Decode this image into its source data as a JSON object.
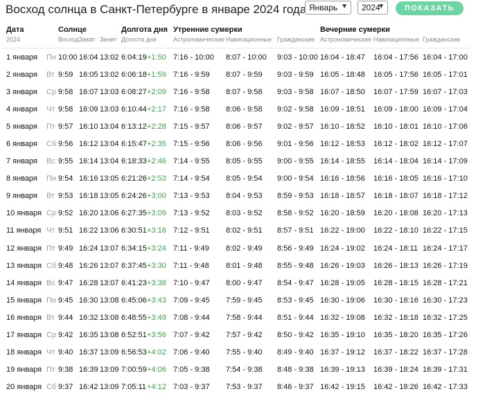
{
  "title": "Восход солнца в Санкт-Петербурге в январе 2024 года",
  "controls": {
    "month": "Январь",
    "year": "2024",
    "button": "ПОКАЗАТЬ"
  },
  "headers": {
    "date": "Дата",
    "year": "2024",
    "sun": "Солнце",
    "daylen": "Долгота дня",
    "morning": "Утренние сумерки",
    "evening": "Вечерние сумерки",
    "sub": [
      "Восход",
      "Закат",
      "Зенит",
      "Долгота дня",
      "Астрономические",
      "Навигационные",
      "Гражданские",
      "Астрономические",
      "Навигационные",
      "Гражданские"
    ]
  },
  "rows": [
    {
      "d": "1 января",
      "w": "Пн",
      "rise": "10:00",
      "set": "16:04",
      "zen": "13:02",
      "len": "6:04:19",
      "dl": "+1:50",
      "ma": "7:16 - 10:00",
      "mn": "8:07 - 10:00",
      "mc": "9:03 - 10:00",
      "ea": "16:04 - 18:47",
      "en": "16:04 - 17:56",
      "ec": "16:04 - 17:00"
    },
    {
      "d": "2 января",
      "w": "Вт",
      "rise": "9:59",
      "set": "16:05",
      "zen": "13:02",
      "len": "6:06:18",
      "dl": "+1:59",
      "ma": "7:16 - 9:59",
      "mn": "8:07 - 9:59",
      "mc": "9:03 - 9:59",
      "ea": "16:05 - 18:48",
      "en": "16:05 - 17:56",
      "ec": "16:05 - 17:01"
    },
    {
      "d": "3 января",
      "w": "Ср",
      "rise": "9:58",
      "set": "16:07",
      "zen": "13:03",
      "len": "6:08:27",
      "dl": "+2:09",
      "ma": "7:16 - 9:58",
      "mn": "8:07 - 9:58",
      "mc": "9:03 - 9:58",
      "ea": "16:07 - 18:50",
      "en": "16:07 - 17:59",
      "ec": "16:07 - 17:03"
    },
    {
      "d": "4 января",
      "w": "Чт",
      "rise": "9:58",
      "set": "16:09",
      "zen": "13:03",
      "len": "6:10:44",
      "dl": "+2:17",
      "ma": "7:16 - 9:58",
      "mn": "8:06 - 9:58",
      "mc": "9:02 - 9:58",
      "ea": "16:09 - 18:51",
      "en": "16:09 - 18:00",
      "ec": "16:09 - 17:04"
    },
    {
      "d": "5 января",
      "w": "Пт",
      "rise": "9:57",
      "set": "16:10",
      "zen": "13:04",
      "len": "6:13:12",
      "dl": "+2:28",
      "ma": "7:15 - 9:57",
      "mn": "8:06 - 9:57",
      "mc": "9:02 - 9:57",
      "ea": "16:10 - 18:52",
      "en": "16:10 - 18:01",
      "ec": "16:10 - 17:06"
    },
    {
      "d": "6 января",
      "w": "Сб",
      "rise": "9:56",
      "set": "16:12",
      "zen": "13:04",
      "len": "6:15:47",
      "dl": "+2:35",
      "ma": "7:15 - 9:56",
      "mn": "8:06 - 9:56",
      "mc": "9:01 - 9:56",
      "ea": "16:12 - 18:53",
      "en": "16:12 - 18:02",
      "ec": "16:12 - 17:07"
    },
    {
      "d": "7 января",
      "w": "Вс",
      "rise": "9:55",
      "set": "16:14",
      "zen": "13:04",
      "len": "6:18:33",
      "dl": "+2:46",
      "ma": "7:14 - 9:55",
      "mn": "8:05 - 9:55",
      "mc": "9:00 - 9:55",
      "ea": "16:14 - 18:55",
      "en": "16:14 - 18:04",
      "ec": "16:14 - 17:09"
    },
    {
      "d": "8 января",
      "w": "Пн",
      "rise": "9:54",
      "set": "16:16",
      "zen": "13:05",
      "len": "6:21:26",
      "dl": "+2:53",
      "ma": "7:14 - 9:54",
      "mn": "8:05 - 9:54",
      "mc": "9:00 - 9:54",
      "ea": "16:16 - 18:56",
      "en": "16:16 - 18:05",
      "ec": "16:16 - 17:10"
    },
    {
      "d": "9 января",
      "w": "Вт",
      "rise": "9:53",
      "set": "16:18",
      "zen": "13:05",
      "len": "6:24:26",
      "dl": "+3:00",
      "ma": "7:13 - 9:53",
      "mn": "8:04 - 9:53",
      "mc": "8:59 - 9:53",
      "ea": "16:18 - 18:57",
      "en": "16:18 - 18:07",
      "ec": "16:18 - 17:12"
    },
    {
      "d": "10 января",
      "w": "Ср",
      "rise": "9:52",
      "set": "16:20",
      "zen": "13:06",
      "len": "6:27:35",
      "dl": "+3:09",
      "ma": "7:13 - 9:52",
      "mn": "8:03 - 9:52",
      "mc": "8:58 - 9:52",
      "ea": "16:20 - 18:59",
      "en": "16:20 - 18:08",
      "ec": "16:20 - 17:13"
    },
    {
      "d": "11 января",
      "w": "Чт",
      "rise": "9:51",
      "set": "16:22",
      "zen": "13:06",
      "len": "6:30:51",
      "dl": "+3:16",
      "ma": "7:12 - 9:51",
      "mn": "8:02 - 9:51",
      "mc": "8:57 - 9:51",
      "ea": "16:22 - 19:00",
      "en": "16:22 - 18:10",
      "ec": "16:22 - 17:15"
    },
    {
      "d": "12 января",
      "w": "Пт",
      "rise": "9:49",
      "set": "16:24",
      "zen": "13:07",
      "len": "6:34:15",
      "dl": "+3:24",
      "ma": "7:11 - 9:49",
      "mn": "8:02 - 9:49",
      "mc": "8:56 - 9:49",
      "ea": "16:24 - 19:02",
      "en": "16:24 - 18:11",
      "ec": "16:24 - 17:17"
    },
    {
      "d": "13 января",
      "w": "Сб",
      "rise": "9:48",
      "set": "16:26",
      "zen": "13:07",
      "len": "6:37:45",
      "dl": "+3:30",
      "ma": "7:11 - 9:48",
      "mn": "8:01 - 9:48",
      "mc": "8:55 - 9:48",
      "ea": "16:26 - 19:03",
      "en": "16:26 - 18:13",
      "ec": "16:26 - 17:19"
    },
    {
      "d": "14 января",
      "w": "Вс",
      "rise": "9:47",
      "set": "16:28",
      "zen": "13:07",
      "len": "6:41:23",
      "dl": "+3:38",
      "ma": "7:10 - 9:47",
      "mn": "8:00 - 9:47",
      "mc": "8:54 - 9:47",
      "ea": "16:28 - 19:05",
      "en": "16:28 - 18:15",
      "ec": "16:28 - 17:21"
    },
    {
      "d": "15 января",
      "w": "Пн",
      "rise": "9:45",
      "set": "16:30",
      "zen": "13:08",
      "len": "6:45:06",
      "dl": "+3:43",
      "ma": "7:09 - 9:45",
      "mn": "7:59 - 9:45",
      "mc": "8:53 - 9:45",
      "ea": "16:30 - 19:06",
      "en": "16:30 - 18:16",
      "ec": "16:30 - 17:23"
    },
    {
      "d": "16 января",
      "w": "Вт",
      "rise": "9:44",
      "set": "16:32",
      "zen": "13:08",
      "len": "6:48:55",
      "dl": "+3:49",
      "ma": "7:08 - 9:44",
      "mn": "7:58 - 9:44",
      "mc": "8:51 - 9:44",
      "ea": "16:32 - 19:08",
      "en": "16:32 - 18:18",
      "ec": "16:32 - 17:25"
    },
    {
      "d": "17 января",
      "w": "Ср",
      "rise": "9:42",
      "set": "16:35",
      "zen": "13:08",
      "len": "6:52:51",
      "dl": "+3:56",
      "ma": "7:07 - 9:42",
      "mn": "7:57 - 9:42",
      "mc": "8:50 - 9:42",
      "ea": "16:35 - 19:10",
      "en": "16:35 - 18:20",
      "ec": "16:35 - 17:26"
    },
    {
      "d": "18 января",
      "w": "Чт",
      "rise": "9:40",
      "set": "16:37",
      "zen": "13:09",
      "len": "6:56:53",
      "dl": "+4:02",
      "ma": "7:06 - 9:40",
      "mn": "7:55 - 9:40",
      "mc": "8:49 - 9:40",
      "ea": "16:37 - 19:12",
      "en": "16:37 - 18:22",
      "ec": "16:37 - 17:28"
    },
    {
      "d": "19 января",
      "w": "Пт",
      "rise": "9:38",
      "set": "16:39",
      "zen": "13:09",
      "len": "7:00:59",
      "dl": "+4:06",
      "ma": "7:05 - 9:38",
      "mn": "7:54 - 9:38",
      "mc": "8:48 - 9:38",
      "ea": "16:39 - 19:13",
      "en": "16:39 - 18:24",
      "ec": "16:39 - 17:31"
    },
    {
      "d": "20 января",
      "w": "Сб",
      "rise": "9:37",
      "set": "16:42",
      "zen": "13:09",
      "len": "7:05:11",
      "dl": "+4:12",
      "ma": "7:03 - 9:37",
      "mn": "7:53 - 9:37",
      "mc": "8:46 - 9:37",
      "ea": "16:42 - 19:15",
      "en": "16:42 - 18:26",
      "ec": "16:42 - 17:33"
    }
  ]
}
